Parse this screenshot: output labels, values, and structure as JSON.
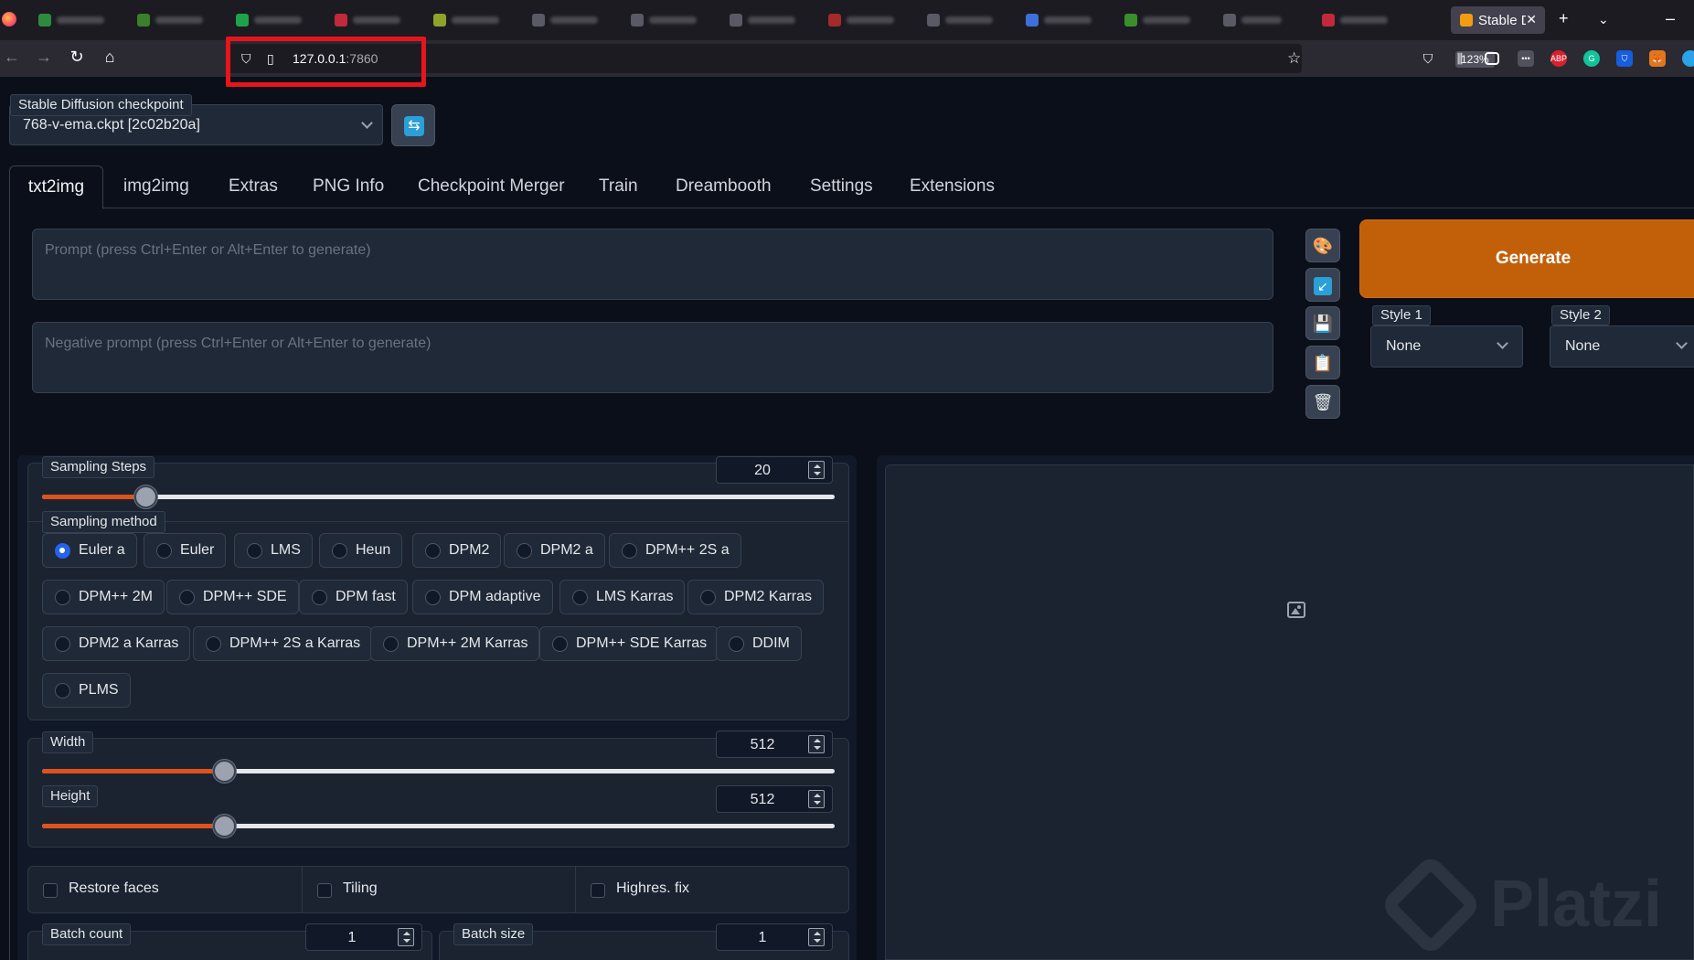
{
  "browser": {
    "active_tab_title": "Stable D",
    "url_host": "127.0.0.1",
    "url_port": ":7860",
    "zoom": "123%"
  },
  "checkpoint": {
    "label": "Stable Diffusion checkpoint",
    "value": "768-v-ema.ckpt [2c02b20a]"
  },
  "tabs": [
    "txt2img",
    "img2img",
    "Extras",
    "PNG Info",
    "Checkpoint Merger",
    "Train",
    "Dreambooth",
    "Settings",
    "Extensions"
  ],
  "prompt": {
    "placeholder": "Prompt (press Ctrl+Enter or Alt+Enter to generate)",
    "negative_placeholder": "Negative prompt (press Ctrl+Enter or Alt+Enter to generate)"
  },
  "generate_label": "Generate",
  "styles": [
    {
      "label": "Style 1",
      "value": "None"
    },
    {
      "label": "Style 2",
      "value": "None"
    }
  ],
  "sampling_steps": {
    "label": "Sampling Steps",
    "value": "20",
    "fraction": 0.13
  },
  "sampling_method": {
    "label": "Sampling method",
    "options": [
      "Euler a",
      "Euler",
      "LMS",
      "Heun",
      "DPM2",
      "DPM2 a",
      "DPM++ 2S a",
      "DPM++ 2M",
      "DPM++ SDE",
      "DPM fast",
      "DPM adaptive",
      "LMS Karras",
      "DPM2 Karras",
      "DPM2 a Karras",
      "DPM++ 2S a Karras",
      "DPM++ 2M Karras",
      "DPM++ SDE Karras",
      "DDIM",
      "PLMS"
    ],
    "selected": "Euler a"
  },
  "width": {
    "label": "Width",
    "value": "512",
    "fraction": 0.23
  },
  "height": {
    "label": "Height",
    "value": "512",
    "fraction": 0.23
  },
  "checkboxes": [
    "Restore faces",
    "Tiling",
    "Highres. fix"
  ],
  "batch_count": {
    "label": "Batch count",
    "value": "1"
  },
  "batch_size": {
    "label": "Batch size",
    "value": "1"
  },
  "watermark": "Platzi",
  "colors": {
    "accent": "#e0521c",
    "generate": "#c2600a",
    "highlight": "#e8141c"
  }
}
